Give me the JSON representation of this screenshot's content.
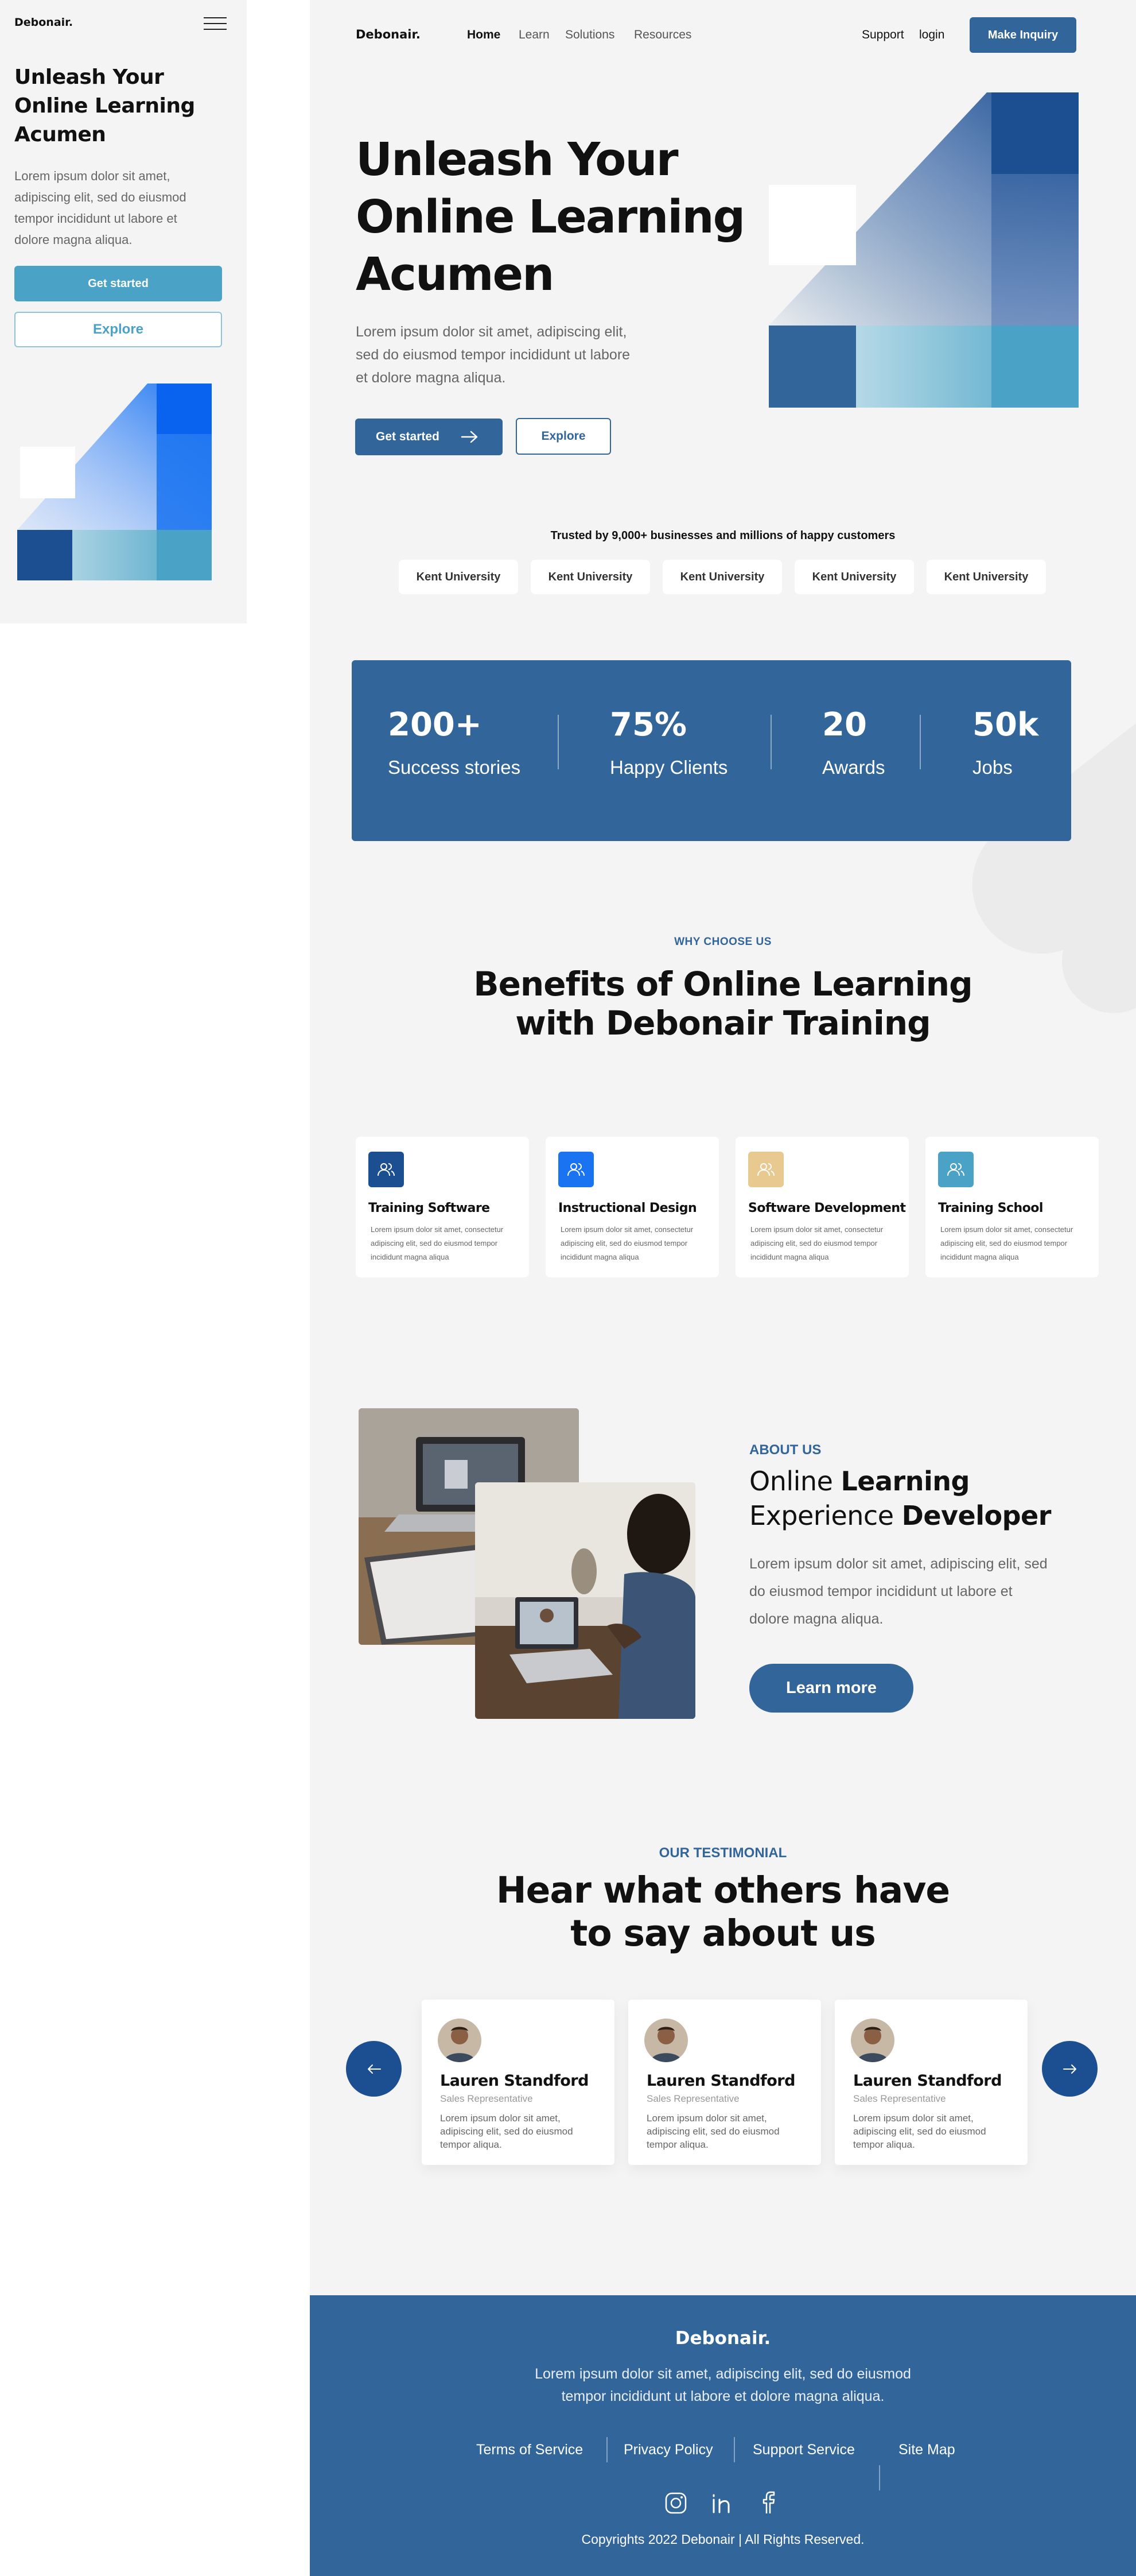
{
  "brand": "Debonair.",
  "colors": {
    "primary": "#326599",
    "teal": "#4aa3c6",
    "navy": "#1b4f91",
    "bright_blue": "#1a73f0",
    "bg": "#f4f4f5"
  },
  "mobile": {
    "logo": "Debonair.",
    "menu_icon": "hamburger-menu-icon",
    "title_lines": [
      "Unleash Your",
      "Online Learning",
      "Acumen"
    ],
    "desc_lines": [
      "Lorem ipsum dolor sit amet,",
      "adipiscing elit, sed do eiusmod",
      "tempor incididunt ut labore et",
      "dolore magna aliqua."
    ],
    "get_started": "Get started",
    "explore": "Explore"
  },
  "nav": {
    "logo": "Debonair.",
    "links": [
      "Home",
      "Learn",
      "Solutions",
      "Resources"
    ],
    "active": "Home",
    "support": "Support",
    "login": "login",
    "cta": "Make Inquiry"
  },
  "hero": {
    "title_lines": [
      "Unleash Your",
      "Online Learning",
      "Acumen"
    ],
    "desc_lines": [
      "Lorem ipsum dolor sit amet,  adipiscing elit,",
      "sed do eiusmod tempor incididunt ut labore",
      "et dolore magna aliqua."
    ],
    "get_started": "Get started",
    "arrow_icon": "arrow-right-icon",
    "explore": "Explore"
  },
  "trusted": {
    "text": "Trusted by 9,000+ businesses and millions of happy customers",
    "logos": [
      "Kent University",
      "Kent University",
      "Kent University",
      "Kent University",
      "Kent University"
    ]
  },
  "stats": [
    {
      "value": "200+",
      "label": "Success stories"
    },
    {
      "value": "75%",
      "label": "Happy Clients"
    },
    {
      "value": "20",
      "label": "Awards"
    },
    {
      "value": "50k",
      "label": "Jobs"
    }
  ],
  "why": {
    "eyebrow": "WHY CHOOSE US",
    "title_lines": [
      "Benefits of Online Learning",
      "with Debonair Training"
    ],
    "cards": [
      {
        "title": "Training Software",
        "icon": "users-icon",
        "icon_bg": "#1b4f91",
        "desc_lines": [
          "Lorem ipsum dolor sit amet, consectetur",
          "adipiscing elit, sed do eiusmod tempor",
          "incididunt magna aliqua"
        ]
      },
      {
        "title": "Instructional Design",
        "icon": "users-icon",
        "icon_bg": "#1a73f0",
        "desc_lines": [
          "Lorem ipsum dolor sit amet, consectetur",
          "adipiscing elit, sed do eiusmod tempor",
          "incididunt magna aliqua"
        ]
      },
      {
        "title": "Software Development",
        "icon": "users-icon",
        "icon_bg": "#e8c98f",
        "desc_lines": [
          "Lorem ipsum dolor sit amet, consectetur",
          "adipiscing elit, sed do eiusmod tempor",
          "incididunt magna aliqua"
        ]
      },
      {
        "title": "Training School",
        "icon": "users-icon",
        "icon_bg": "#4aa3c6",
        "desc_lines": [
          "Lorem ipsum dolor sit amet, consectetur",
          "adipiscing elit, sed do eiusmod tempor",
          "incididunt magna aliqua"
        ]
      }
    ]
  },
  "about": {
    "eyebrow": "ABOUT US",
    "title_line1_plain": "Online ",
    "title_line1_bold": "Learning",
    "title_line2_plain": "Experience ",
    "title_line2_bold": "Developer",
    "desc_lines": [
      "Lorem ipsum dolor sit amet,  adipiscing elit, sed",
      "do eiusmod tempor incididunt ut labore et",
      "dolore magna aliqua."
    ],
    "cta": "Learn more"
  },
  "testimonials": {
    "eyebrow": "OUR TESTIMONIAL",
    "title_lines": [
      "Hear what others have",
      "to say about us"
    ],
    "prev_icon": "arrow-left-icon",
    "next_icon": "arrow-right-icon",
    "items": [
      {
        "name": "Lauren Standford",
        "role": "Sales Representative",
        "quote_lines": [
          "Lorem ipsum dolor sit amet,",
          "adipiscing elit, sed do eiusmod",
          "tempor aliqua."
        ]
      },
      {
        "name": "Lauren Standford",
        "role": "Sales Representative",
        "quote_lines": [
          "Lorem ipsum dolor sit amet,",
          "adipiscing elit, sed do eiusmod",
          "tempor aliqua."
        ]
      },
      {
        "name": "Lauren Standford",
        "role": "Sales Representative",
        "quote_lines": [
          "Lorem ipsum dolor sit amet,",
          "adipiscing elit, sed do eiusmod",
          "tempor aliqua."
        ]
      }
    ]
  },
  "footer": {
    "logo": "Debonair.",
    "desc_lines": [
      "Lorem ipsum dolor sit amet,  adipiscing elit, sed do eiusmod",
      "tempor incididunt ut labore et dolore magna aliqua."
    ],
    "links": [
      "Terms of Service",
      "Privacy Policy",
      "Support Service",
      "Site Map"
    ],
    "social_icons": [
      "instagram-icon",
      "linkedin-icon",
      "facebook-icon"
    ],
    "copyright": "Copyrights 2022 Debonair | All Rights Reserved."
  }
}
